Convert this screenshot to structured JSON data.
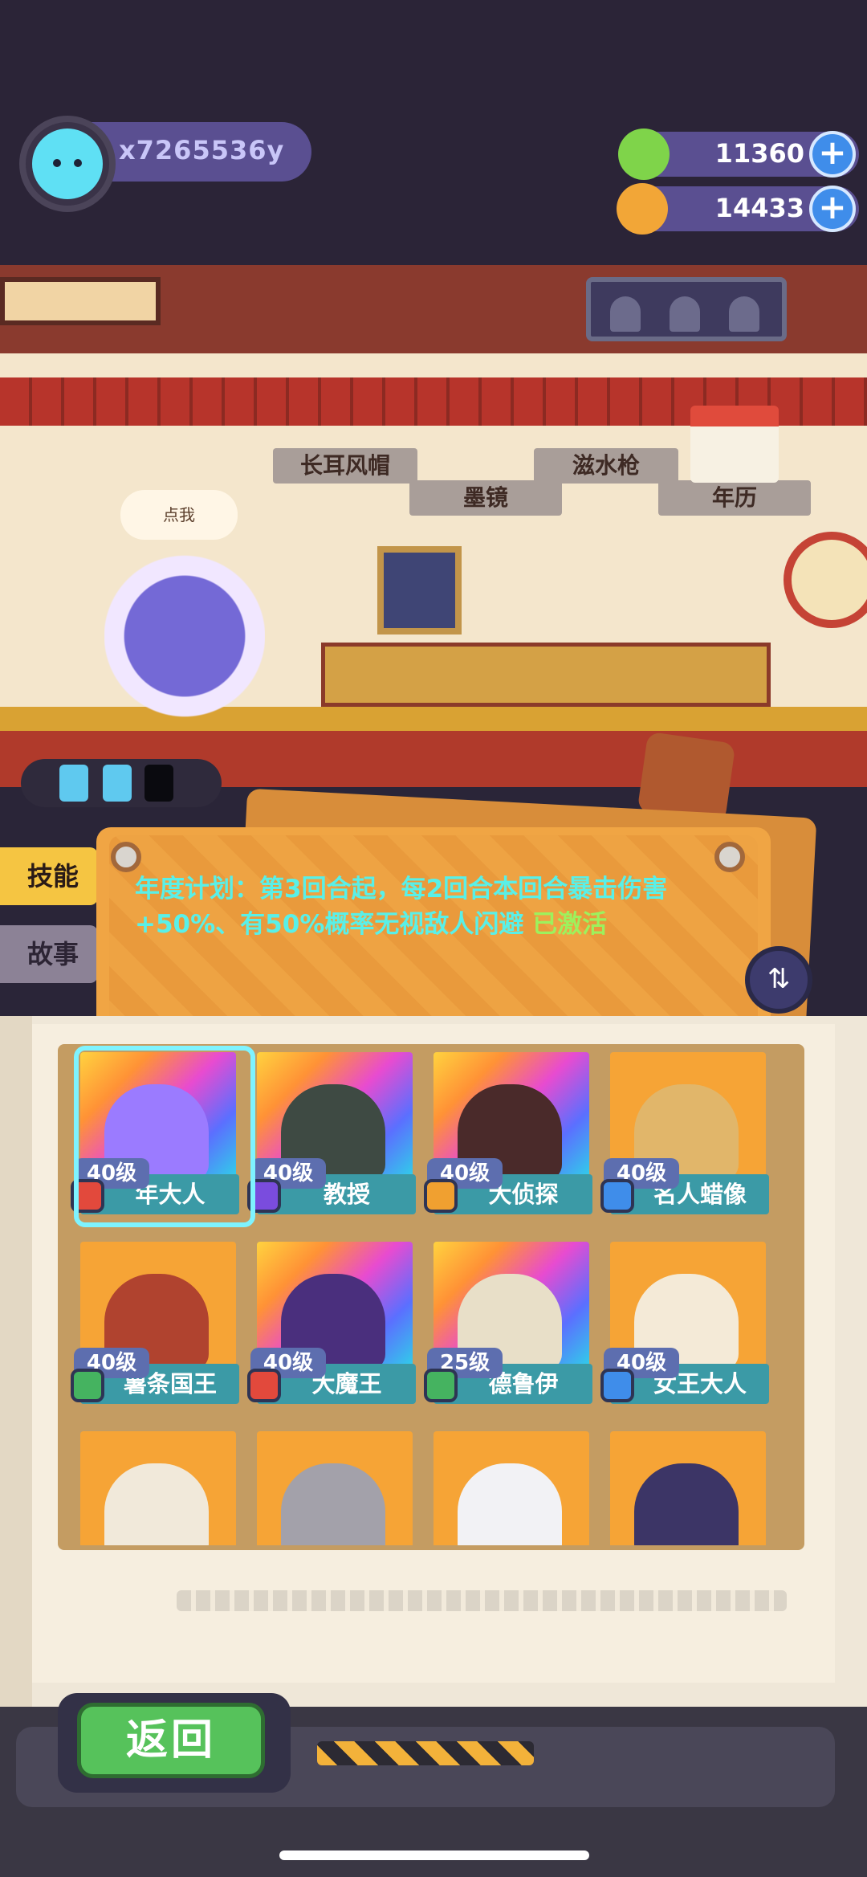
{
  "user": {
    "name": "x7265536y"
  },
  "currencies": [
    {
      "name": "donut",
      "value": "11360",
      "color": "#7fd44a"
    },
    {
      "name": "coin",
      "value": "14433",
      "color": "#f2a637"
    }
  ],
  "shop": {
    "speech": "点我",
    "items": [
      "长耳风帽",
      "墨镜",
      "滋水枪",
      "年历"
    ]
  },
  "tabs": {
    "skill": "技能",
    "story": "故事"
  },
  "note": {
    "text": "年度计划：第3回合起，每2回合本回合暴击伤害+50%、有50%概率无视敌人闪避",
    "status": "已激活"
  },
  "cards": [
    {
      "name": "年大人",
      "level": "40级",
      "badge": "#e2493c",
      "art": "#9b7bff"
    },
    {
      "name": "教授",
      "level": "40级",
      "badge": "#7a4cde",
      "art": "#3e4a43"
    },
    {
      "name": "大侦探",
      "level": "40级",
      "badge": "#f0a030",
      "art": "#4a2a2a"
    },
    {
      "name": "名人蜡像",
      "level": "40级",
      "badge": "#3f8dea",
      "art": "#e1b66a"
    },
    {
      "name": "薯条国王",
      "level": "40级",
      "badge": "#45b360",
      "art": "#b0432f"
    },
    {
      "name": "大魔王",
      "level": "40级",
      "badge": "#e2493c",
      "art": "#4a2f7d"
    },
    {
      "name": "德鲁伊",
      "level": "25级",
      "badge": "#45b360",
      "art": "#e8dfc8"
    },
    {
      "name": "女王大人",
      "level": "40级",
      "badge": "#3f8dea",
      "art": "#f4ead7"
    },
    {
      "name": "",
      "level": "",
      "badge": "",
      "art": "#f1e9da"
    },
    {
      "name": "",
      "level": "",
      "badge": "",
      "art": "#a3a1aa"
    },
    {
      "name": "",
      "level": "",
      "badge": "",
      "art": "#f2f2f5"
    },
    {
      "name": "",
      "level": "",
      "badge": "",
      "art": "#3c3566"
    }
  ],
  "back": "返回"
}
